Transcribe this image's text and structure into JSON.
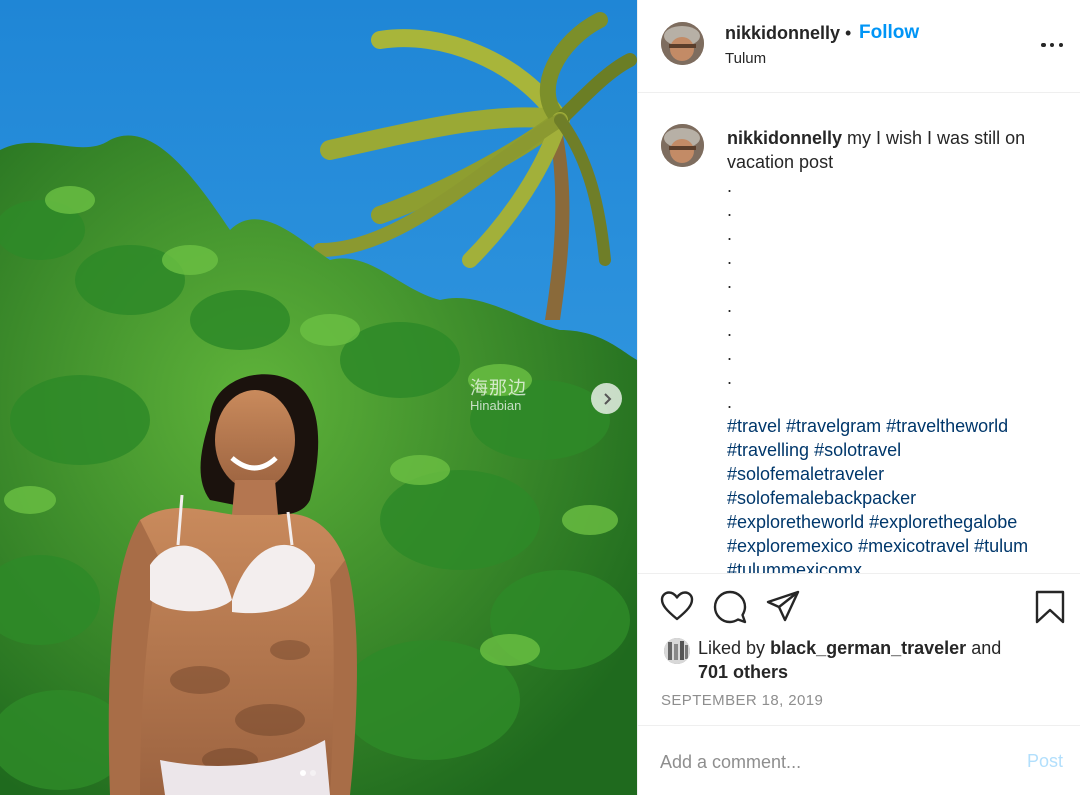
{
  "photo": {
    "watermark_cn": "海那边",
    "watermark_en": "Hinabian",
    "carousel": {
      "total_slides": 2,
      "active_index": 0
    }
  },
  "header": {
    "username": "nikkidonnelly",
    "separator": "•",
    "follow_label": "Follow",
    "location": "Tulum"
  },
  "caption": {
    "username": "nikkidonnelly",
    "text": "my I wish I was still on vacation post",
    "dots": [
      ".",
      ".",
      ".",
      ".",
      ".",
      ".",
      ".",
      ".",
      ".",
      "."
    ],
    "hashtags": [
      "#travel",
      "#travelgram",
      "#traveltheworld",
      "#travelling",
      "#solotravel",
      "#solofemaletraveler",
      "#solofemalebackpacker",
      "#exploretheworld",
      "#explorethegalobe",
      "#exploremexico",
      "#mexicotravel",
      "#tulum",
      "#tulummexicomx"
    ]
  },
  "actions": {
    "like_icon": "heart-icon",
    "comment_icon": "comment-bubble-icon",
    "share_icon": "paper-plane-icon",
    "save_icon": "bookmark-icon"
  },
  "likes": {
    "prefix": "Liked by",
    "user": "black_german_traveler",
    "joiner": "and",
    "others": "701 others"
  },
  "date": "SEPTEMBER 18, 2019",
  "comment_box": {
    "placeholder": "Add a comment...",
    "post_label": "Post"
  },
  "colors": {
    "link_blue": "#0095f6",
    "hashtag": "#00376b",
    "muted": "#8e8e8e",
    "post_disabled": "#b2dffc"
  }
}
